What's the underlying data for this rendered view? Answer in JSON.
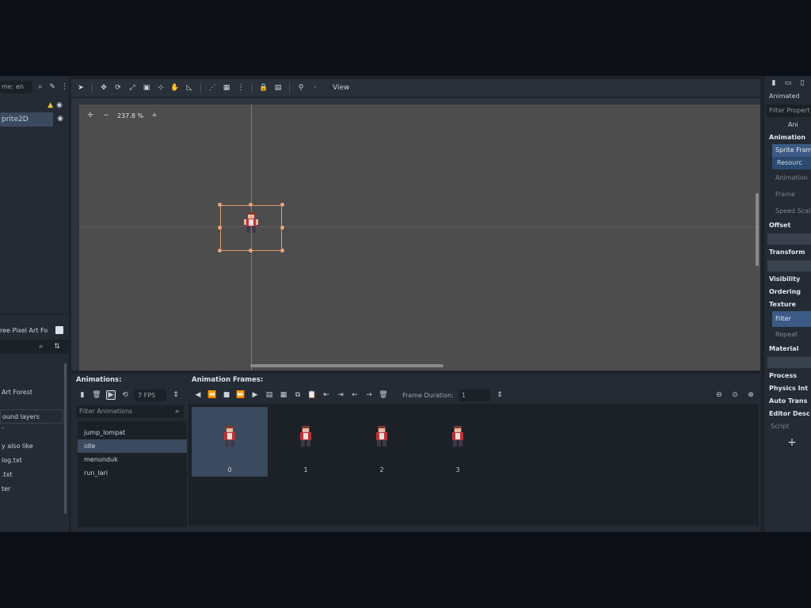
{
  "scene": {
    "filter_text": "me: en",
    "nodes": [
      {
        "label": "",
        "warning": true
      },
      {
        "label": "prite2D",
        "selected": true
      }
    ]
  },
  "filesystem": {
    "path": "ree Pixel Art Fo",
    "items": [
      {
        "label": "Art Forest",
        "boxed": false
      },
      {
        "label": "ound layers",
        "boxed": true
      },
      {
        "label": "-",
        "boxed": false
      },
      {
        "label": "y also like",
        "boxed": false
      },
      {
        "label": "log.txt",
        "boxed": false
      },
      {
        "label": ".txt",
        "boxed": false
      },
      {
        "label": "ter",
        "boxed": false
      }
    ]
  },
  "toolbar": {
    "view_label": "View"
  },
  "viewport": {
    "zoom_label": "237.8 %",
    "zoom_minus": "−",
    "zoom_plus": "+"
  },
  "animations": {
    "title": "Animations:",
    "fps": "7 FPS",
    "filter_placeholder": "Filter Animations",
    "list": [
      "jump_lompat",
      "idle",
      "menunduk",
      "run_lari"
    ],
    "selected_index": 1
  },
  "frames": {
    "title": "Animation Frames:",
    "duration_label": "Frame Duration:",
    "duration_value": "1",
    "items": [
      "0",
      "1",
      "2",
      "3"
    ],
    "selected_index": 0
  },
  "inspector": {
    "node_label": "Animated",
    "filter_placeholder": "Filter Propert",
    "class_label": "Ani",
    "rows": [
      {
        "text": "Animation",
        "style": "b"
      },
      {
        "text": "Sprite Fram",
        "style": "hl"
      },
      {
        "text": "Resourc",
        "style": "blue"
      },
      {
        "text": "Animation",
        "style": "dim"
      },
      {
        "text": "Frame",
        "style": "dim"
      },
      {
        "text": "Speed Scal",
        "style": "dim"
      },
      {
        "text": "Offset",
        "style": "b"
      },
      {
        "text": "",
        "style": "field"
      },
      {
        "text": "Transform",
        "style": "b"
      },
      {
        "text": "",
        "style": "field"
      },
      {
        "text": "Visibility",
        "style": "b"
      },
      {
        "text": "Ordering",
        "style": "b"
      },
      {
        "text": "Texture",
        "style": "b"
      },
      {
        "text": "Filter",
        "style": "hl"
      },
      {
        "text": "Repeat",
        "style": "dim"
      },
      {
        "text": "Material",
        "style": "b"
      },
      {
        "text": "",
        "style": "field"
      },
      {
        "text": "Process",
        "style": "b"
      },
      {
        "text": "Physics Int",
        "style": "b"
      },
      {
        "text": "Auto Trans",
        "style": "b"
      },
      {
        "text": "Editor Desc",
        "style": "b"
      },
      {
        "text": "Script",
        "style": "dim"
      }
    ],
    "add_label": "+"
  },
  "colors": {
    "selection": "#3b4a5e",
    "accent_blue": "#3b5a85",
    "gizmo": "#e29a6a",
    "viewport_bg": "#4d4d4d"
  }
}
